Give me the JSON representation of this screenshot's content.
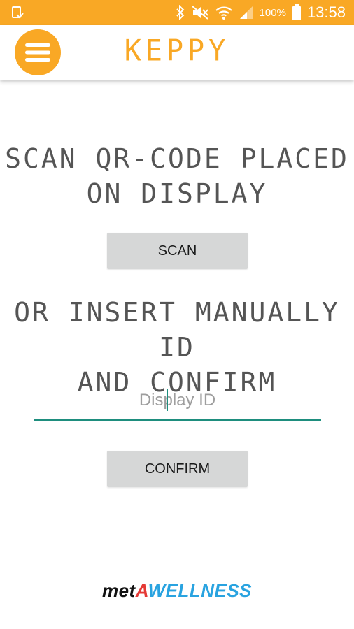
{
  "status_bar": {
    "battery": "100%",
    "time": "13:58",
    "icons": [
      "notification-icon",
      "bluetooth-icon",
      "mute-icon",
      "wifi-icon",
      "signal-icon",
      "battery-icon"
    ],
    "color": "#f9a825"
  },
  "app_bar": {
    "title": "KEPPY",
    "menu_icon": "hamburger-menu-icon",
    "accent": "#f9a825"
  },
  "main": {
    "scan_heading_line1": "SCAN QR-CODE PLACED",
    "scan_heading_line2": "ON DISPLAY",
    "scan_button": "SCAN",
    "manual_heading_line1": "OR INSERT MANUALLY ID",
    "manual_heading_line2": "AND CONFIRM",
    "display_id": {
      "value": "",
      "placeholder": "Display ID"
    },
    "confirm_button": "CONFIRM"
  },
  "footer": {
    "brand_part1": "met",
    "brand_part2": "A",
    "brand_part3": "WELLNESS",
    "colors": {
      "part1": "#111111",
      "part2": "#e53935",
      "part3": "#29a3e0"
    }
  }
}
